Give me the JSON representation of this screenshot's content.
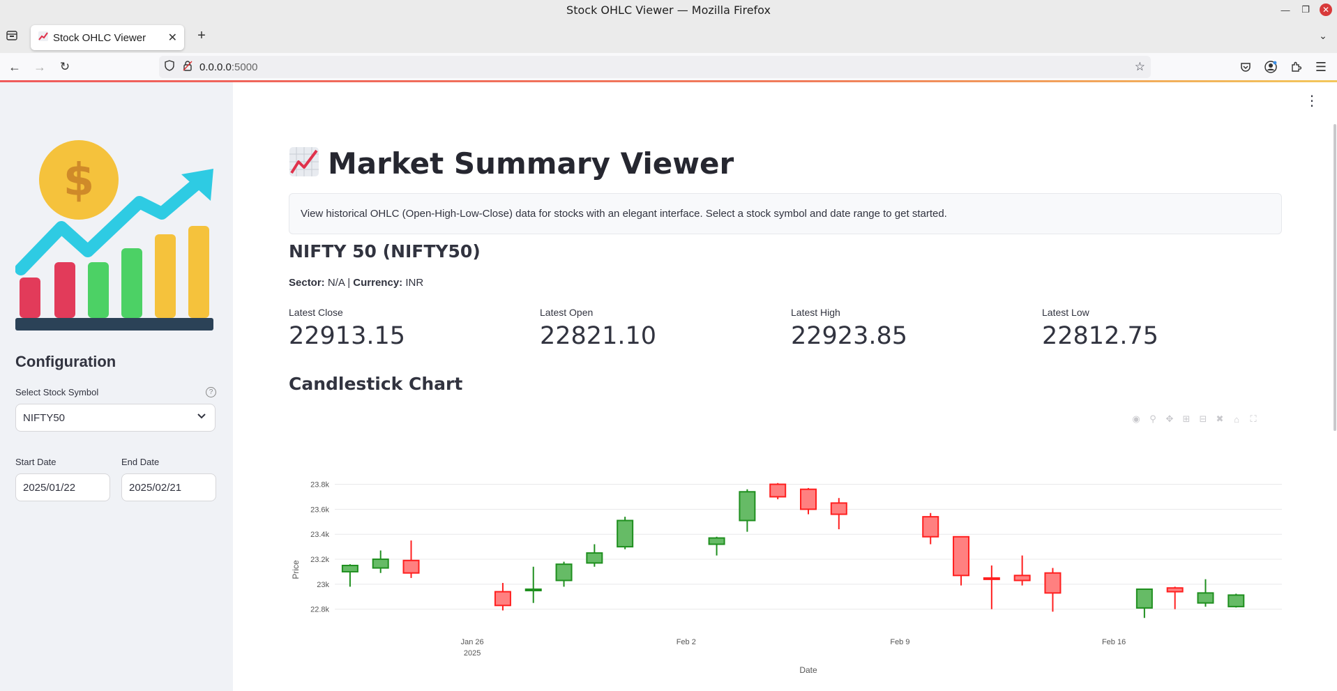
{
  "window": {
    "title": "Stock OHLC Viewer — Mozilla Firefox"
  },
  "browser": {
    "tab_title": "Stock OHLC Viewer",
    "url_host": "0.0.0.0",
    "url_port": ":5000"
  },
  "sidebar": {
    "heading": "Configuration",
    "symbol_label": "Select Stock Symbol",
    "symbol_value": "NIFTY50",
    "start_label": "Start Date",
    "start_value": "2025/01/22",
    "end_label": "End Date",
    "end_value": "2025/02/21"
  },
  "main": {
    "title": "Market Summary Viewer",
    "info": "View historical OHLC (Open-High-Low-Close) data for stocks with an elegant interface. Select a stock symbol and date range to get started.",
    "stock_heading": "NIFTY 50 (NIFTY50)",
    "sector_label": "Sector:",
    "sector_value": "N/A",
    "sep": "|",
    "currency_label": "Currency:",
    "currency_value": "INR",
    "metrics": [
      {
        "label": "Latest Close",
        "value": "22913.15"
      },
      {
        "label": "Latest Open",
        "value": "22821.10"
      },
      {
        "label": "Latest High",
        "value": "22923.85"
      },
      {
        "label": "Latest Low",
        "value": "22812.75"
      }
    ],
    "chart_heading": "Candlestick Chart"
  },
  "colors": {
    "up": "#2ca02c",
    "down": "#ff0000",
    "accent": "#ff4b4b",
    "sidebar_bg": "#f0f2f6"
  },
  "chart_data": {
    "type": "candlestick",
    "xlabel": "Date",
    "ylabel": "Price",
    "ylim": [
      22720,
      23870
    ],
    "yticks": [
      22800,
      23000,
      23200,
      23400,
      23600,
      23800
    ],
    "ytick_labels": [
      "22.8k",
      "23k",
      "23.2k",
      "23.4k",
      "23.6k",
      "23.8k"
    ],
    "xlim": [
      "2025-01-21T12:00",
      "2025-02-21T12:00"
    ],
    "xticks": [
      {
        "date": "2025-01-26",
        "label": "Jan 26",
        "sub": "2025"
      },
      {
        "date": "2025-02-02",
        "label": "Feb 2",
        "sub": ""
      },
      {
        "date": "2025-02-09",
        "label": "Feb 9",
        "sub": ""
      },
      {
        "date": "2025-02-16",
        "label": "Feb 16",
        "sub": ""
      }
    ],
    "grid": true,
    "candles": [
      {
        "date": "2025-01-22",
        "open": 23100,
        "high": 23160,
        "low": 22980,
        "close": 23150
      },
      {
        "date": "2025-01-23",
        "open": 23130,
        "high": 23270,
        "low": 23090,
        "close": 23200
      },
      {
        "date": "2025-01-24",
        "open": 23190,
        "high": 23350,
        "low": 23050,
        "close": 23090
      },
      {
        "date": "2025-01-27",
        "open": 22940,
        "high": 23010,
        "low": 22790,
        "close": 22830
      },
      {
        "date": "2025-01-28",
        "open": 22960,
        "high": 23140,
        "low": 22850,
        "close": 22960
      },
      {
        "date": "2025-01-29",
        "open": 23030,
        "high": 23180,
        "low": 22980,
        "close": 23160
      },
      {
        "date": "2025-01-30",
        "open": 23170,
        "high": 23320,
        "low": 23140,
        "close": 23250
      },
      {
        "date": "2025-01-31",
        "open": 23300,
        "high": 23540,
        "low": 23280,
        "close": 23510
      },
      {
        "date": "2025-02-03",
        "open": 23320,
        "high": 23380,
        "low": 23230,
        "close": 23370
      },
      {
        "date": "2025-02-04",
        "open": 23510,
        "high": 23760,
        "low": 23420,
        "close": 23740
      },
      {
        "date": "2025-02-05",
        "open": 23800,
        "high": 23810,
        "low": 23680,
        "close": 23700
      },
      {
        "date": "2025-02-06",
        "open": 23760,
        "high": 23770,
        "low": 23560,
        "close": 23600
      },
      {
        "date": "2025-02-07",
        "open": 23650,
        "high": 23690,
        "low": 23440,
        "close": 23560
      },
      {
        "date": "2025-02-10",
        "open": 23540,
        "high": 23570,
        "low": 23320,
        "close": 23380
      },
      {
        "date": "2025-02-11",
        "open": 23380,
        "high": 23380,
        "low": 22990,
        "close": 23070
      },
      {
        "date": "2025-02-12",
        "open": 23050,
        "high": 23150,
        "low": 22800,
        "close": 23045
      },
      {
        "date": "2025-02-13",
        "open": 23070,
        "high": 23230,
        "low": 22990,
        "close": 23030
      },
      {
        "date": "2025-02-14",
        "open": 23090,
        "high": 23130,
        "low": 22780,
        "close": 22930
      },
      {
        "date": "2025-02-17",
        "open": 22810,
        "high": 22960,
        "low": 22730,
        "close": 22960
      },
      {
        "date": "2025-02-18",
        "open": 22970,
        "high": 22980,
        "low": 22800,
        "close": 22940
      },
      {
        "date": "2025-02-19",
        "open": 22850,
        "high": 23040,
        "low": 22820,
        "close": 22930
      },
      {
        "date": "2025-02-20",
        "open": 22821,
        "high": 22924,
        "low": 22813,
        "close": 22913
      }
    ]
  }
}
